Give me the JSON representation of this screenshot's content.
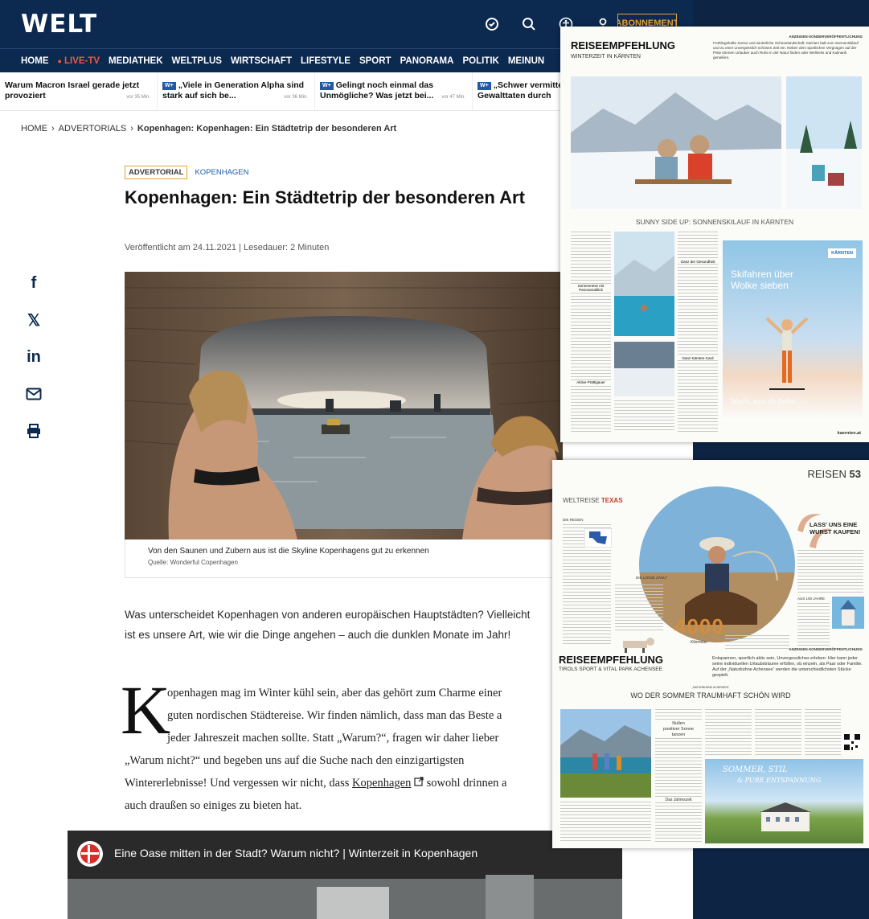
{
  "welt": {
    "logo": "WELT",
    "subscribe_label": "ABONNEMENT",
    "nav": [
      "HOME",
      "LIVE-TV",
      "MEDIATHEK",
      "WELTPLUS",
      "WIRTSCHAFT",
      "LIFESTYLE",
      "SPORT",
      "PANORAMA",
      "POLITIK",
      "MEINUN"
    ],
    "ticker": [
      {
        "badge": "",
        "text": "Warum Macron Israel gerade jetzt provoziert",
        "age": "vor 35 Min."
      },
      {
        "badge": "W+",
        "text": "„Viele in Generation Alpha sind stark auf sich be...",
        "age": "vor 36 Min."
      },
      {
        "badge": "W+",
        "text": "Gelingt noch einmal das Unmögliche? Was jetzt bei...",
        "age": "vor 47 Min."
      },
      {
        "badge": "W+",
        "text": "„Schwer vermitte bei Gewalttaten durch",
        "age": ""
      }
    ],
    "breadcrumb": {
      "home": "HOME",
      "section": "ADVERTORIALS",
      "current": "Kopenhagen: Kopenhagen: Ein Städtetrip der besonderen Art"
    },
    "tag_adv": "ADVERTORIAL",
    "tag_topic": "KOPENHAGEN",
    "headline": "Kopenhagen: Ein Städtetrip der besonderen Art",
    "meta": "Veröffentlicht am 24.11.2021 | Lesedauer: 2 Minuten",
    "caption": "Von den Saunen und Zubern aus ist die Skyline Kopenhagens gut zu erkennen",
    "source": "Quelle: Wonderful Copenhagen",
    "para1": "Was unterscheidet Kopenhagen von anderen europäischen Hauptstädten? Vielleicht ist es unsere Art, wie wir die Dinge angehen – auch die dunklen Monate im Jahr!",
    "dropcap": "K",
    "para2": {
      "line1": "openhagen mag im Winter kühl sein, aber das gehört zum Charme einer",
      "line2": "guten nordischen Städtereise. Wir finden nämlich, dass man das Beste a",
      "line3": "jeder Jahreszeit machen sollte. Statt „Warum?“, fragen wir daher lieber",
      "line4": "„Warum nicht?“ und begeben uns auf die Suche nach den einzigartigsten",
      "line5a": "Wintererlebnisse! Und vergessen wir nicht, dass ",
      "link": "Kopenhagen",
      "line5b": " sowohl drinnen a",
      "line6": "auch draußen so einiges zu bieten hat."
    },
    "video_title": "Eine Oase mitten in der Stadt? Warum nicht? | Winterzeit in Kopenhagen"
  },
  "mag1": {
    "title": "REISEEMPFEHLUNG",
    "subtitle": "WINTERZEIT IN KÄRNTEN",
    "notice": "ANZEIGEN-SONDERVERÖFFENTLICHUNG",
    "intro": "Frühlingshafte Sonne und winterliche Schneelandschaft: Kärnten lädt zum Sonnenskilauf und zu einer unvergesslich schönen Zeit ein. Neben dem sportlichen Vergnügen auf der Piste können Urlauber auch Ruhe in der Natur finden oder Wellness und Kulinarik genießen.",
    "section_title": "SUNNY SIDE UP: SONNENSKILAUF IN KÄRNTEN",
    "ad_text": "Skifahren über Wolke sieben",
    "ad_brand": "KÄRNTEN",
    "ad_slogan": "Mach, was du liebst ...",
    "footer": "kaernten.at",
    "sub1": "Sonnenreise mit Panoramablick",
    "sub2": "Ganz der Gesundheit",
    "sub3": "Ganz Kärnten-Card",
    "sub4": "Aktive Prättigauer"
  },
  "mag2": {
    "section": "REISEN",
    "page_no": "53",
    "series": "WELTREISE",
    "series_name": "TEXAS",
    "big_number": "4000",
    "big_unit": "Kilometer",
    "side_head": "LASS' UNS EINE WURST KAUFEN!",
    "col1_head": "DIE REISEN",
    "col2_head": "DIE LÄNGE ZÄHLT",
    "col3_head": "AUS 100 JAHRE"
  },
  "mag3": {
    "notice": "ANZEIGEN-SONDERVERÖFFENTLICHUNG",
    "title": "REISEEMPFEHLUNG",
    "subtitle": "TIROLS SPORT & VITAL PARK ACHENSEE",
    "intro": "Entspannen, sportlich aktiv sein, Unvergessliches erleben: Hier kann jeder seine individuellen Urlaubsträume erfüllen, ob einzeln, als Paar oder Familie. Auf der „Naturbühne Achensee“ werden die unterschiedlichsten Stücke gespielt.",
    "headline": "WO DER SOMMER TRAUMHAFT SCHÖN WIRD",
    "kicker": "„NATURBÜHNE ACHENSEE“",
    "pull1": "Nullen",
    "pull2": "positiver Sonne",
    "pull3": "tanzen",
    "sub": "Das Jahreszeit",
    "ad_line1": "SOMMER, STIL",
    "ad_line2": "& PURE ENTSPANNUNG"
  }
}
